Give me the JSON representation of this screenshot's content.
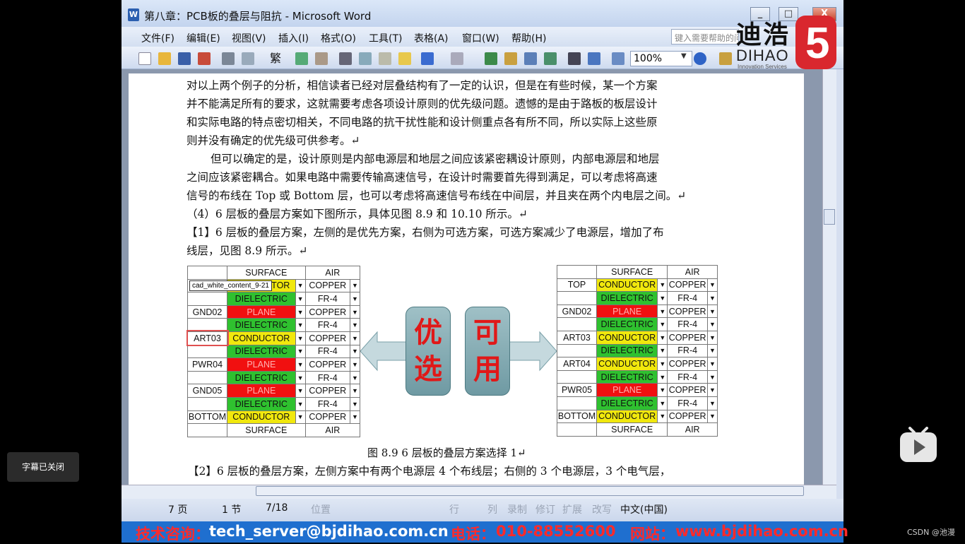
{
  "window": {
    "title": "第八章：PCB板的叠层与阻抗 - Microsoft Word",
    "app_icon": "W",
    "controls": {
      "minimize": "_",
      "restore": "□",
      "close": "X"
    }
  },
  "menu": [
    "文件(F)",
    "编辑(E)",
    "视图(V)",
    "插入(I)",
    "格式(O)",
    "工具(T)",
    "表格(A)",
    "窗口(W)",
    "帮助(H)"
  ],
  "help_search": {
    "placeholder": "键入需要帮助的问题"
  },
  "toolbar": {
    "zoom": "100%",
    "traditional_chinese": "繁"
  },
  "logo": {
    "cn": "迪浩",
    "en": "DIHAO",
    "sub": "Innovation Services",
    "mark": "5"
  },
  "document": {
    "paragraphs": [
      "对以上两个例子的分析，相信读者已经对层叠结构有了一定的认识，但是在有些时候，某一个方案",
      "并不能满足所有的要求，这就需要考虑各项设计原则的优先级问题。遗憾的是由于路板的板层设计",
      "和实际电路的特点密切相关，不同电路的抗干扰性能和设计侧重点各有所不同，所以实际上这些原",
      "则并没有确定的优先级可供参考。↵",
      "但可以确定的是，设计原则是内部电源层和地层之间应该紧密耦设计原则，内部电源层和地层",
      "之间应该紧密耦合。如果电路中需要传输高速信号，在设计时需要首先得到满足，可以考虑将高速",
      "信号的布线在 Top 或 Bottom 层，也可以考虑将高速信号布线在中间层，并且夹在两个内电层之间。↵",
      "（4）6 层板的叠层方案如下图所示，具体见图 8.9 和 10.10 所示。↵",
      "【1】6 层板的叠层方案，左侧的是优先方案，右侧为可选方案，可选方案减少了电源层，增加了布",
      "线层，见图 8.9 所示。↵"
    ],
    "figure": {
      "left_table": {
        "header": [
          "",
          "SURFACE",
          "AIR"
        ],
        "rows": [
          {
            "label": "",
            "material": "CONDUCTOR",
            "type": "y",
            "air": "COPPER"
          },
          {
            "label": "",
            "material": "DIELECTRIC",
            "type": "g",
            "air": "FR-4"
          },
          {
            "label": "GND02",
            "material": "PLANE",
            "type": "r",
            "air": "COPPER"
          },
          {
            "label": "",
            "material": "DIELECTRIC",
            "type": "g",
            "air": "FR-4"
          },
          {
            "label": "ART03",
            "material": "CONDUCTOR",
            "type": "y",
            "air": "COPPER"
          },
          {
            "label": "",
            "material": "DIELECTRIC",
            "type": "g",
            "air": "FR-4"
          },
          {
            "label": "PWR04",
            "material": "PLANE",
            "type": "r",
            "air": "COPPER"
          },
          {
            "label": "",
            "material": "DIELECTRIC",
            "type": "g",
            "air": "FR-4"
          },
          {
            "label": "GND05",
            "material": "PLANE",
            "type": "r",
            "air": "COPPER"
          },
          {
            "label": "",
            "material": "DIELECTRIC",
            "type": "g",
            "air": "FR-4"
          },
          {
            "label": "BOTTOM",
            "material": "CONDUCTOR",
            "type": "y",
            "air": "COPPER"
          }
        ],
        "footer": [
          "",
          "SURFACE",
          "AIR"
        ],
        "tooltip": "cad_white_content_9-21"
      },
      "right_table": {
        "header": [
          "",
          "SURFACE",
          "AIR"
        ],
        "rows": [
          {
            "label": "TOP",
            "material": "CONDUCTOR",
            "type": "y",
            "air": "COPPER"
          },
          {
            "label": "",
            "material": "DIELECTRIC",
            "type": "g",
            "air": "FR-4"
          },
          {
            "label": "GND02",
            "material": "PLANE",
            "type": "r",
            "air": "COPPER"
          },
          {
            "label": "",
            "material": "DIELECTRIC",
            "type": "g",
            "air": "FR-4"
          },
          {
            "label": "ART03",
            "material": "CONDUCTOR",
            "type": "y",
            "air": "COPPER"
          },
          {
            "label": "",
            "material": "DIELECTRIC",
            "type": "g",
            "air": "FR-4"
          },
          {
            "label": "ART04",
            "material": "CONDUCTOR",
            "type": "y",
            "air": "COPPER"
          },
          {
            "label": "",
            "material": "DIELECTRIC",
            "type": "g",
            "air": "FR-4"
          },
          {
            "label": "PWR05",
            "material": "PLANE",
            "type": "r",
            "air": "COPPER"
          },
          {
            "label": "",
            "material": "DIELECTRIC",
            "type": "g",
            "air": "FR-4"
          },
          {
            "label": "BOTTOM",
            "material": "CONDUCTOR",
            "type": "y",
            "air": "COPPER"
          }
        ],
        "footer": [
          "",
          "SURFACE",
          "AIR"
        ]
      },
      "preferred": "优选",
      "optional": "可用"
    },
    "caption": "图 8.9   6 层板的叠层方案选择 1↵",
    "next_paragraph": "【2】6 层板的叠层方案，左侧方案中有两个电源层 4 个布线层；右侧的 3 个电源层，3 个电气层，"
  },
  "status": {
    "page": "7 页",
    "section": "1 节",
    "pos": "7/18",
    "at": "位置",
    "line": "行",
    "col": "列",
    "rec": "录制",
    "trk": "修订",
    "ext": "扩展",
    "ovr": "改写",
    "lang": "中文(中国)"
  },
  "banner": {
    "tech_label": "技术咨询：",
    "tech_value": "tech_server@bjdihao.com.cn",
    "phone_label": "电话：",
    "phone_value": "010-88552600",
    "site_label": "网站：",
    "site_value": "www.bjdihao.com.cn"
  },
  "overlay": {
    "subtitle_toggle": "字幕已关闭",
    "watermark": "CSDN @池漫"
  },
  "colors": {
    "conductor": "#f1e80d",
    "dielectric": "#2fc12f",
    "plane": "#f11010",
    "banner": "#1f6fcf"
  }
}
